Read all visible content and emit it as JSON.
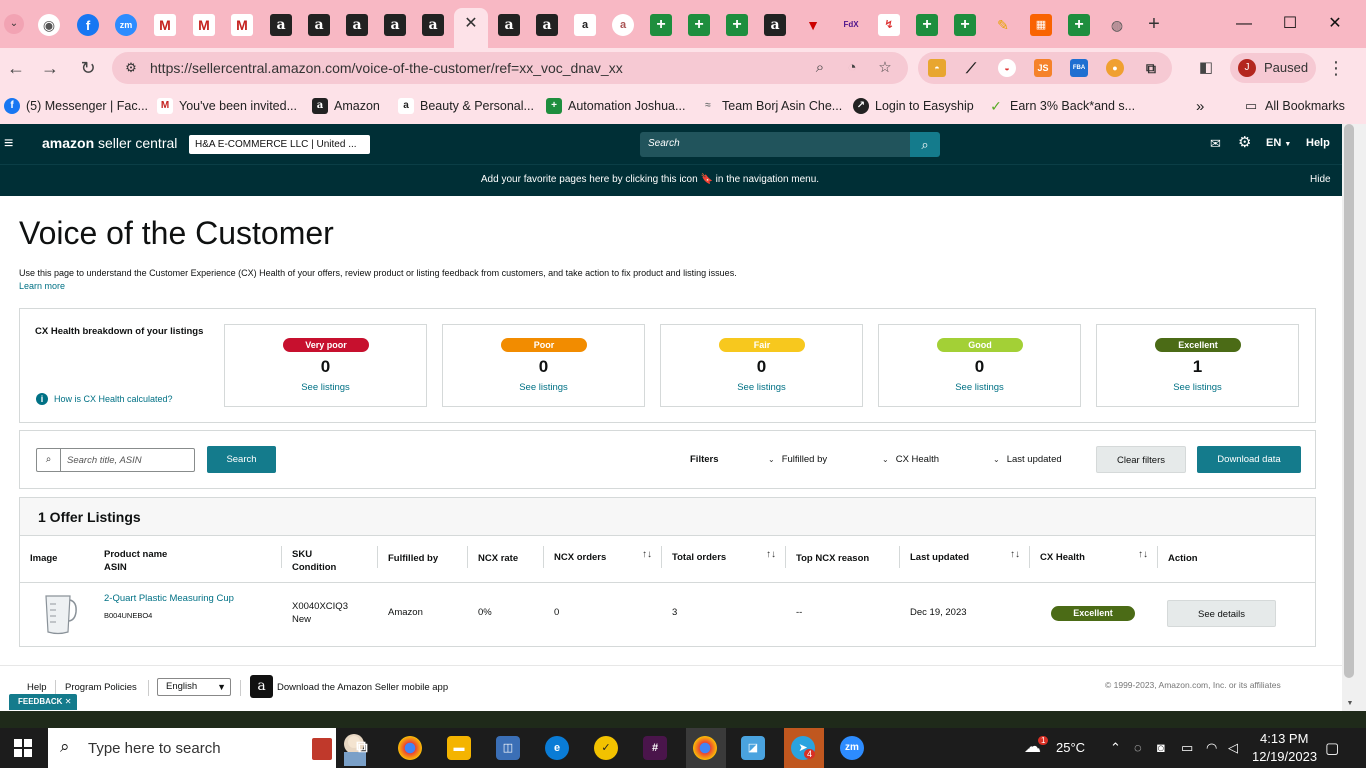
{
  "browser": {
    "active_tab_close": "✕",
    "new_tab": "+",
    "url": "https://sellercentral.amazon.com/voice-of-the-customer/ref=xx_voc_dnav_xx",
    "profile_initial": "J",
    "profile_status": "Paused",
    "tab_icons": [
      "chrome-icon",
      "facebook-icon",
      "zoom-icon",
      "gmail-icon",
      "gmail-icon",
      "gmail-icon",
      "amazon-icon",
      "amazon-icon",
      "amazon-icon",
      "amazon-icon",
      "amazon-icon",
      "amazon-icon",
      "amazon-icon",
      "amazon-smile-icon",
      "amazon-icon",
      "sheets-icon",
      "sheets-icon",
      "sheets-icon",
      "amazon-icon",
      "triangle-icon",
      "fedex-icon",
      "app-icon",
      "sheets-icon",
      "sheets-icon",
      "pencil-icon",
      "homedepot-icon",
      "sheets-icon",
      "globe-icon"
    ],
    "bookmarks": [
      {
        "label": "(5) Messenger | Fac...",
        "icon": "facebook-icon"
      },
      {
        "label": "You've been invited...",
        "icon": "gmail-icon"
      },
      {
        "label": "Amazon",
        "icon": "amazon-icon"
      },
      {
        "label": "Beauty & Personal...",
        "icon": "amazon-icon"
      },
      {
        "label": "Automation Joshua...",
        "icon": "sheets-icon"
      },
      {
        "label": "Team Borj Asin Che...",
        "icon": "app-icon"
      },
      {
        "label": "Login to Easyship",
        "icon": "easyship-icon"
      },
      {
        "label": "Earn 3% Back*and s...",
        "icon": "rakuten-icon"
      }
    ],
    "all_bookmarks": "All Bookmarks",
    "extension_labels": {
      "js": "JS",
      "fba": "FBA"
    }
  },
  "header": {
    "logo_bold": "amazon",
    "logo_rest": " seller central",
    "account": "H&A E-COMMERCE LLC | United ...",
    "search_placeholder": "Search",
    "language": "EN",
    "help": "Help",
    "favorites_message": "Add your favorite pages here by clicking this icon 🔖 in the navigation menu.",
    "hide": "Hide"
  },
  "page": {
    "title": "Voice of the Customer",
    "description": "Use this page to understand the Customer Experience (CX) Health of your offers, review product or listing feedback from customers, and take action to fix product and listing issues.",
    "learn_more": "Learn more"
  },
  "cx_health": {
    "heading": "CX Health breakdown of your listings",
    "how_link": "How is CX Health calculated?",
    "cards": [
      {
        "label": "Very poor",
        "count": "0",
        "link": "See listings",
        "color": "#c7102e",
        "text_color": "#ffffff"
      },
      {
        "label": "Poor",
        "count": "0",
        "link": "See listings",
        "color": "#f28c00",
        "text_color": "#ffffff"
      },
      {
        "label": "Fair",
        "count": "0",
        "link": "See listings",
        "color": "#f7c81e",
        "text_color": "#ffffff"
      },
      {
        "label": "Good",
        "count": "0",
        "link": "See listings",
        "color": "#a3d036",
        "text_color": "#ffffff"
      },
      {
        "label": "Excellent",
        "count": "1",
        "link": "See listings",
        "color": "#4b6b16",
        "text_color": "#ffffff"
      }
    ]
  },
  "filters": {
    "search_placeholder": "Search title, ASIN",
    "search_button": "Search",
    "filters_label": "Filters",
    "fulfilled_by": "Fulfilled by",
    "cx_health": "CX Health",
    "last_updated": "Last updated",
    "clear": "Clear filters",
    "download": "Download data"
  },
  "listings": {
    "title": "1 Offer Listings",
    "columns": {
      "image": "Image",
      "product_name": "Product name",
      "asin": "ASIN",
      "sku": "SKU",
      "condition": "Condition",
      "fulfilled_by": "Fulfilled by",
      "ncx_rate": "NCX rate",
      "ncx_orders": "NCX orders",
      "total_orders": "Total orders",
      "top_ncx_reason": "Top NCX reason",
      "last_updated": "Last updated",
      "cx_health": "CX Health",
      "action": "Action"
    },
    "sort_glyph": "↑↓",
    "row": {
      "product_name": "2-Quart Plastic Measuring Cup",
      "asin": "B004UNEBO4",
      "sku": "X0040XCIQ3",
      "condition": "New",
      "fulfilled_by": "Amazon",
      "ncx_rate": "0%",
      "ncx_orders": "0",
      "total_orders": "3",
      "top_ncx_reason": "--",
      "last_updated": "Dec 19, 2023",
      "cx_health": "Excellent",
      "action": "See details"
    }
  },
  "footer": {
    "help": "Help",
    "policies": "Program Policies",
    "language": "English",
    "app": "Download the Amazon Seller mobile app",
    "copyright": "© 1999-2023, Amazon.com, Inc. or its affiliates",
    "feedback": "FEEDBACK"
  },
  "taskbar": {
    "search": "Type here to search",
    "zoom_label": "zm",
    "badge": "4",
    "weather_badge": "1",
    "temperature": "25°C",
    "time": "4:13 PM",
    "date": "12/19/2023"
  }
}
